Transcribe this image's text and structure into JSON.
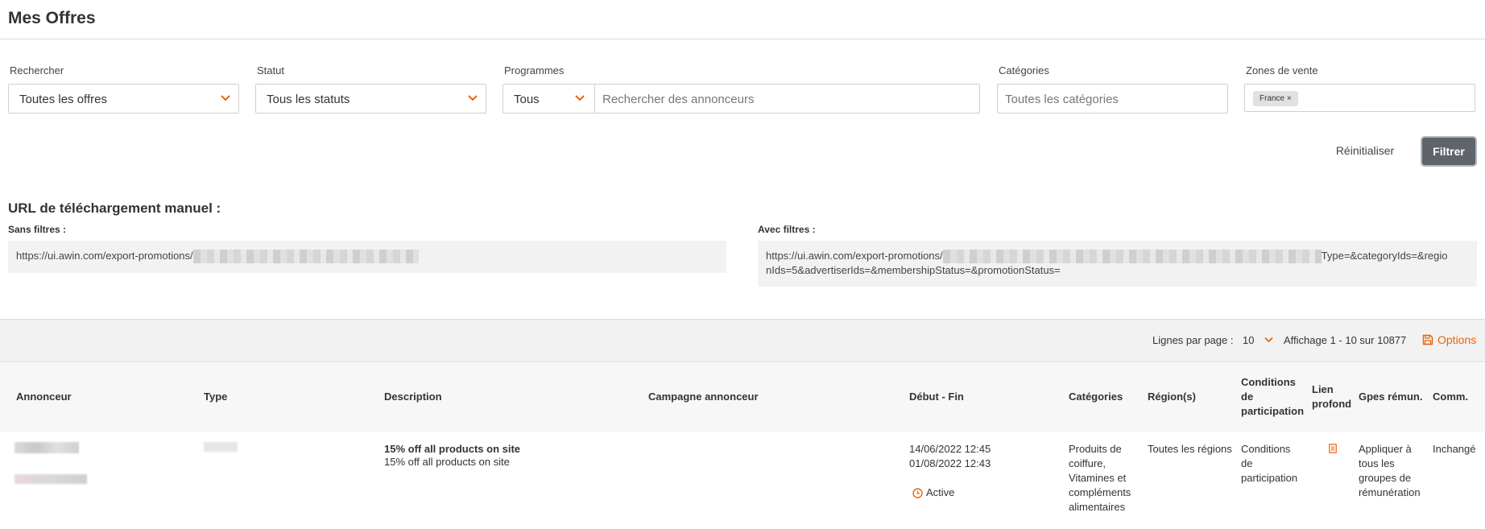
{
  "page": {
    "title": "Mes Offres"
  },
  "filters": {
    "search": {
      "label": "Rechercher",
      "value": "Toutes les offres"
    },
    "status": {
      "label": "Statut",
      "value": "Tous les statuts"
    },
    "programs": {
      "label": "Programmes",
      "value": "Tous",
      "search_placeholder": "Rechercher des annonceurs"
    },
    "categories": {
      "label": "Catégories",
      "placeholder": "Toutes les catégories"
    },
    "zones": {
      "label": "Zones de vente",
      "tags": [
        "France ×"
      ]
    },
    "reset_label": "Réinitialiser",
    "filter_label": "Filtrer"
  },
  "download": {
    "title": "URL de téléchargement manuel :",
    "without_filters": {
      "label": "Sans filtres :",
      "url_prefix": "https://ui.awin.com/export-promotions/"
    },
    "with_filters": {
      "label": "Avec filtres :",
      "url_prefix": "https://ui.awin.com/export-promotions/",
      "url_suffix_line1": "Type=&categoryIds=&regio",
      "url_suffix_line2": "nIds=5&advertiserIds=&membershipStatus=&promotionStatus="
    }
  },
  "toolbar": {
    "rows_label": "Lignes par page :",
    "rows_value": "10",
    "display_info": "Affichage 1 - 10 sur 10877",
    "options_label": "Options"
  },
  "table": {
    "headers": {
      "advertiser": "Annonceur",
      "type": "Type",
      "description": "Description",
      "campaign": "Campagne annonceur",
      "dates": "Début - Fin",
      "categories": "Catégories",
      "regions": "Région(s)",
      "conditions": [
        "Conditions",
        "de",
        "participation"
      ],
      "deep_link": [
        "Lien",
        "profond"
      ],
      "groups": "Gpes rémun.",
      "comm": "Comm."
    },
    "rows": [
      {
        "description_title": "15% off all products on site",
        "description_sub": "15% off all products on site",
        "start": "14/06/2022 12:45",
        "end": "01/08/2022 12:43",
        "status": "Active",
        "categories": [
          "Produits de",
          "coiffure,",
          "Vitamines et",
          "compléments",
          "alimentaires"
        ],
        "regions": "Toutes les régions",
        "conditions": [
          "Conditions",
          "de",
          "participation"
        ],
        "groups": [
          "Appliquer à",
          "tous les",
          "groupes de",
          "rémunération"
        ],
        "comm": "Inchangé"
      }
    ]
  },
  "colors": {
    "accent": "#e8630a",
    "filter_button": "#5f646b",
    "toolbar_bg": "#f2f2f2"
  }
}
